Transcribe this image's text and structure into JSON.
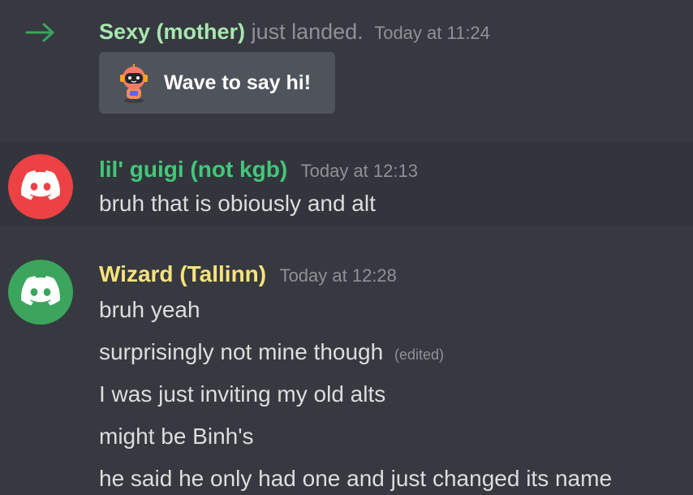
{
  "join": {
    "username": "Sexy (mother)",
    "text": "just landed.",
    "timestamp": "Today at 11:24",
    "wave_label": "Wave to say hi!",
    "user_color": "#a9e6b0",
    "arrow_color": "#3ba55d"
  },
  "messages": [
    {
      "username": "lil' guigi (not kgb)",
      "username_color": "#43c77a",
      "avatar_color": "#ed4245",
      "avatar_icon": "discord-logo-icon",
      "timestamp": "Today at 12:13",
      "lines": [
        {
          "text": "bruh that is obiously and alt",
          "edited": ""
        }
      ]
    },
    {
      "username": "Wizard (Tallinn)",
      "username_color": "#f8e27a",
      "avatar_color": "#3ba55d",
      "avatar_icon": "discord-logo-icon",
      "timestamp": "Today at 12:28",
      "lines": [
        {
          "text": "bruh yeah",
          "edited": ""
        },
        {
          "text": "surprisingly not mine though",
          "edited": "(edited)"
        },
        {
          "text": "I was just inviting my old alts",
          "edited": ""
        },
        {
          "text": "might be Binh's",
          "edited": ""
        },
        {
          "text": "he said he only had one and just changed its name",
          "edited": ""
        }
      ]
    }
  ]
}
